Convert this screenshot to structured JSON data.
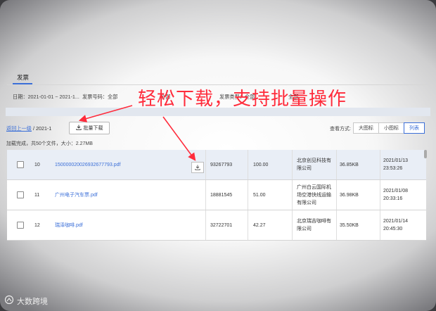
{
  "tab": {
    "label": "发票"
  },
  "filters": [
    {
      "text": "日期：2021-01-01 ~ 2021-1..."
    },
    {
      "text": "发票号码：全部"
    },
    {
      "text": "全部"
    },
    {
      "text": "发票类型：全部"
    },
    {
      "text": "全部"
    }
  ],
  "breadcrumb": {
    "back": "返回上一级",
    "path": "/ 2021-1"
  },
  "batch_download_label": "批量下载",
  "view": {
    "label": "查看方式:",
    "options": [
      "大图标",
      "小图标",
      "列表"
    ],
    "active": "列表"
  },
  "status": "加载完成，共50个文件，大小：2.27MB",
  "rows": [
    {
      "num": "10",
      "file": "150000020026932677793.pdf",
      "code": "93267793",
      "amount": "100.00",
      "company": "北京创见科技有限公司",
      "size": "36.85KB",
      "date": "2021/01/13 23:53:26"
    },
    {
      "num": "11",
      "file": "广州电子汽车票.pdf",
      "code": "18881545",
      "amount": "51.00",
      "company": "广州白云国际机场空港快线运输有限公司",
      "size": "36.98KB",
      "date": "2021/01/08 20:33:16"
    },
    {
      "num": "12",
      "file": "瑞泽咖啡.pdf",
      "code": "32722701",
      "amount": "42.27",
      "company": "北京瑞吉咖啡有限公司",
      "size": "35.50KB",
      "date": "2021/01/14 20:45:30"
    }
  ],
  "annotation": "轻松下载，支持批量操作",
  "watermark": "大数跨境",
  "colors": {
    "accent": "#3b6fd8",
    "annotation": "#ff2b3b"
  }
}
